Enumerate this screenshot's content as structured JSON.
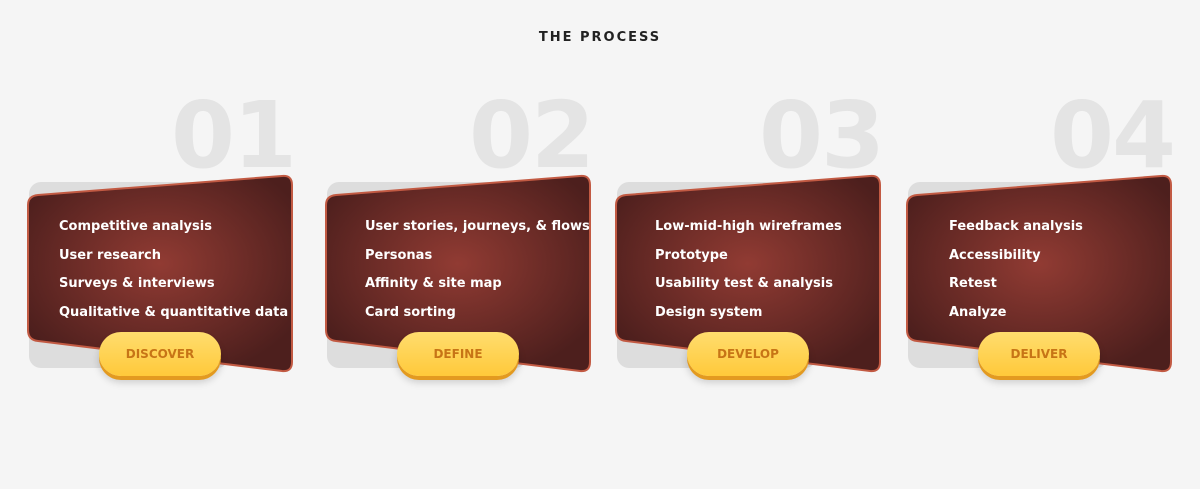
{
  "section": {
    "title": "THE PROCESS"
  },
  "colors": {
    "background": "#f5f5f5",
    "card_dark": "#4d1f1d",
    "card_glow": "#913b33",
    "card_border": "#c25a43",
    "pill": "#ffd15a",
    "pill_text": "#c77416",
    "number": "#e4e4e4"
  },
  "steps": [
    {
      "number": "01",
      "label": "DISCOVER",
      "items": [
        "Competitive analysis",
        "User research",
        "Surveys & interviews",
        "Qualitative & quantitative data"
      ]
    },
    {
      "number": "02",
      "label": "DEFINE",
      "items": [
        "User stories, journeys, & flows",
        "Personas",
        "Affinity & site map",
        "Card sorting"
      ]
    },
    {
      "number": "03",
      "label": "DEVELOP",
      "items": [
        "Low-mid-high wireframes",
        "Prototype",
        "Usability test & analysis",
        "Design system"
      ]
    },
    {
      "number": "04",
      "label": "DELIVER",
      "items": [
        "Feedback analysis",
        "Accessibility",
        "Retest",
        "Analyze"
      ]
    }
  ]
}
